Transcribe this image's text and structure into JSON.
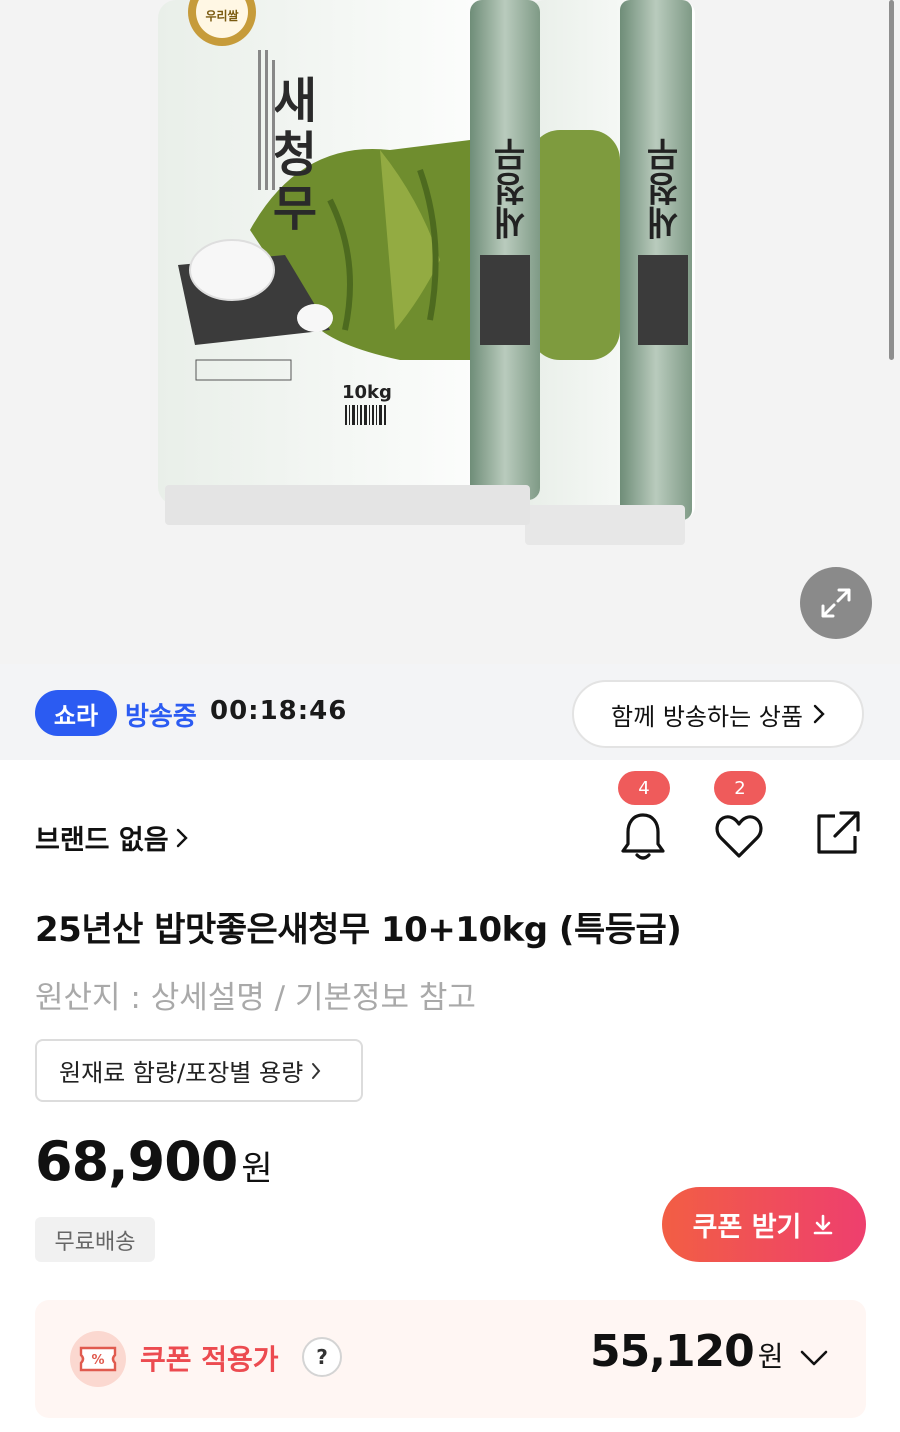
{
  "product_image": {
    "bag_brand": "새청무",
    "bag_weight": "10kg",
    "seal_text": "우리쌀"
  },
  "live": {
    "badge": "쇼라",
    "status": "방송중",
    "timer": "00:18:46",
    "together_label": "함께 방송하는 상품"
  },
  "brand": {
    "label": "브랜드 없음"
  },
  "actions": {
    "alarm_count": "4",
    "like_count": "2"
  },
  "product": {
    "title": "25년산 밥맛좋은새청무 10+10kg (특등급)",
    "origin": "원산지 : 상세설명 / 기본정보 참고",
    "spec_label": "원재료 함량/포장별 용량",
    "price": "68,900",
    "currency": "원",
    "shipping_badge": "무료배송",
    "coupon_button": "쿠폰 받기"
  },
  "coupon": {
    "icon_text": "%",
    "label": "쿠폰 적용가",
    "help": "?",
    "price": "55,120",
    "currency": "원"
  },
  "colors": {
    "accent_blue": "#2b5bf2",
    "accent_red": "#ec4b50",
    "badge_red": "#ef5b5b"
  }
}
